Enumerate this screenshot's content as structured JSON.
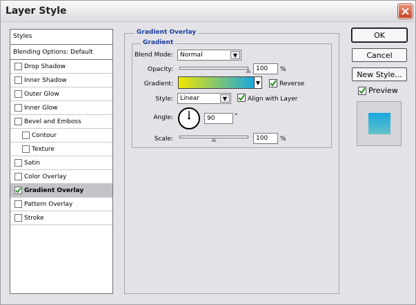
{
  "window": {
    "title": "Layer Style"
  },
  "styles_panel": {
    "header": "Styles",
    "blending_options": "Blending Options: Default",
    "items": [
      {
        "label": "Drop Shadow",
        "checked": false,
        "indent": false,
        "selected": false
      },
      {
        "label": "Inner Shadow",
        "checked": false,
        "indent": false,
        "selected": false
      },
      {
        "label": "Outer Glow",
        "checked": false,
        "indent": false,
        "selected": false
      },
      {
        "label": "Inner Glow",
        "checked": false,
        "indent": false,
        "selected": false
      },
      {
        "label": "Bevel and Emboss",
        "checked": false,
        "indent": false,
        "selected": false
      },
      {
        "label": "Contour",
        "checked": false,
        "indent": true,
        "selected": false
      },
      {
        "label": "Texture",
        "checked": false,
        "indent": true,
        "selected": false
      },
      {
        "label": "Satin",
        "checked": false,
        "indent": false,
        "selected": false
      },
      {
        "label": "Color Overlay",
        "checked": false,
        "indent": false,
        "selected": false
      },
      {
        "label": "Gradient Overlay",
        "checked": true,
        "indent": false,
        "selected": true
      },
      {
        "label": "Pattern Overlay",
        "checked": false,
        "indent": false,
        "selected": false
      },
      {
        "label": "Stroke",
        "checked": false,
        "indent": false,
        "selected": false
      }
    ]
  },
  "gradient_overlay": {
    "section_title": "Gradient Overlay",
    "group_title": "Gradient",
    "blend_mode": {
      "label": "Blend Mode:",
      "value": "Normal"
    },
    "opacity": {
      "label": "Opacity:",
      "value": "100",
      "unit": "%",
      "level": 100
    },
    "gradient": {
      "label": "Gradient:",
      "colors": [
        "#f2e500",
        "#17a7e1"
      ],
      "reverse_label": "Reverse",
      "reverse_checked": true
    },
    "style": {
      "label": "Style:",
      "value": "Linear",
      "align_label": "Align with Layer",
      "align_checked": true
    },
    "angle": {
      "label": "Angle:",
      "value": "90",
      "unit": "°"
    },
    "scale": {
      "label": "Scale:",
      "value": "100",
      "unit": "%",
      "level": 100
    }
  },
  "buttons": {
    "ok": "OK",
    "cancel": "Cancel",
    "new_style": "New Style...",
    "preview_label": "Preview",
    "preview_checked": true
  },
  "colors": {
    "accent_title": "#1a3da0",
    "close_button": "#c5412a",
    "preview_gradient": [
      "#17a7e1",
      "#66c1c8"
    ]
  }
}
